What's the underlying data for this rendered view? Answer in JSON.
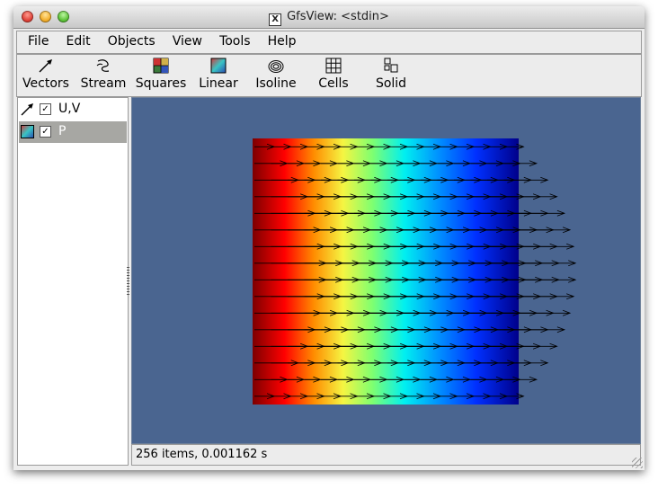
{
  "window": {
    "title": "GfsView: <stdin>"
  },
  "menu": [
    "File",
    "Edit",
    "Objects",
    "View",
    "Tools",
    "Help"
  ],
  "toolbar": [
    {
      "label": "Vectors",
      "icon": "vectors-icon"
    },
    {
      "label": "Stream",
      "icon": "stream-icon"
    },
    {
      "label": "Squares",
      "icon": "squares-icon"
    },
    {
      "label": "Linear",
      "icon": "linear-icon"
    },
    {
      "label": "Isoline",
      "icon": "isoline-icon"
    },
    {
      "label": "Cells",
      "icon": "cells-icon"
    },
    {
      "label": "Solid",
      "icon": "solid-icon"
    }
  ],
  "objects": [
    {
      "label": "U,V",
      "checked": true,
      "selected": false,
      "icon": "vectors-icon"
    },
    {
      "label": "P",
      "checked": true,
      "selected": true,
      "icon": "linear-icon"
    }
  ],
  "status": {
    "text": "256 items, 0.001162 s"
  },
  "colors": {
    "viewport_bg": "#4a6590",
    "selection": "#a7a7a3"
  }
}
